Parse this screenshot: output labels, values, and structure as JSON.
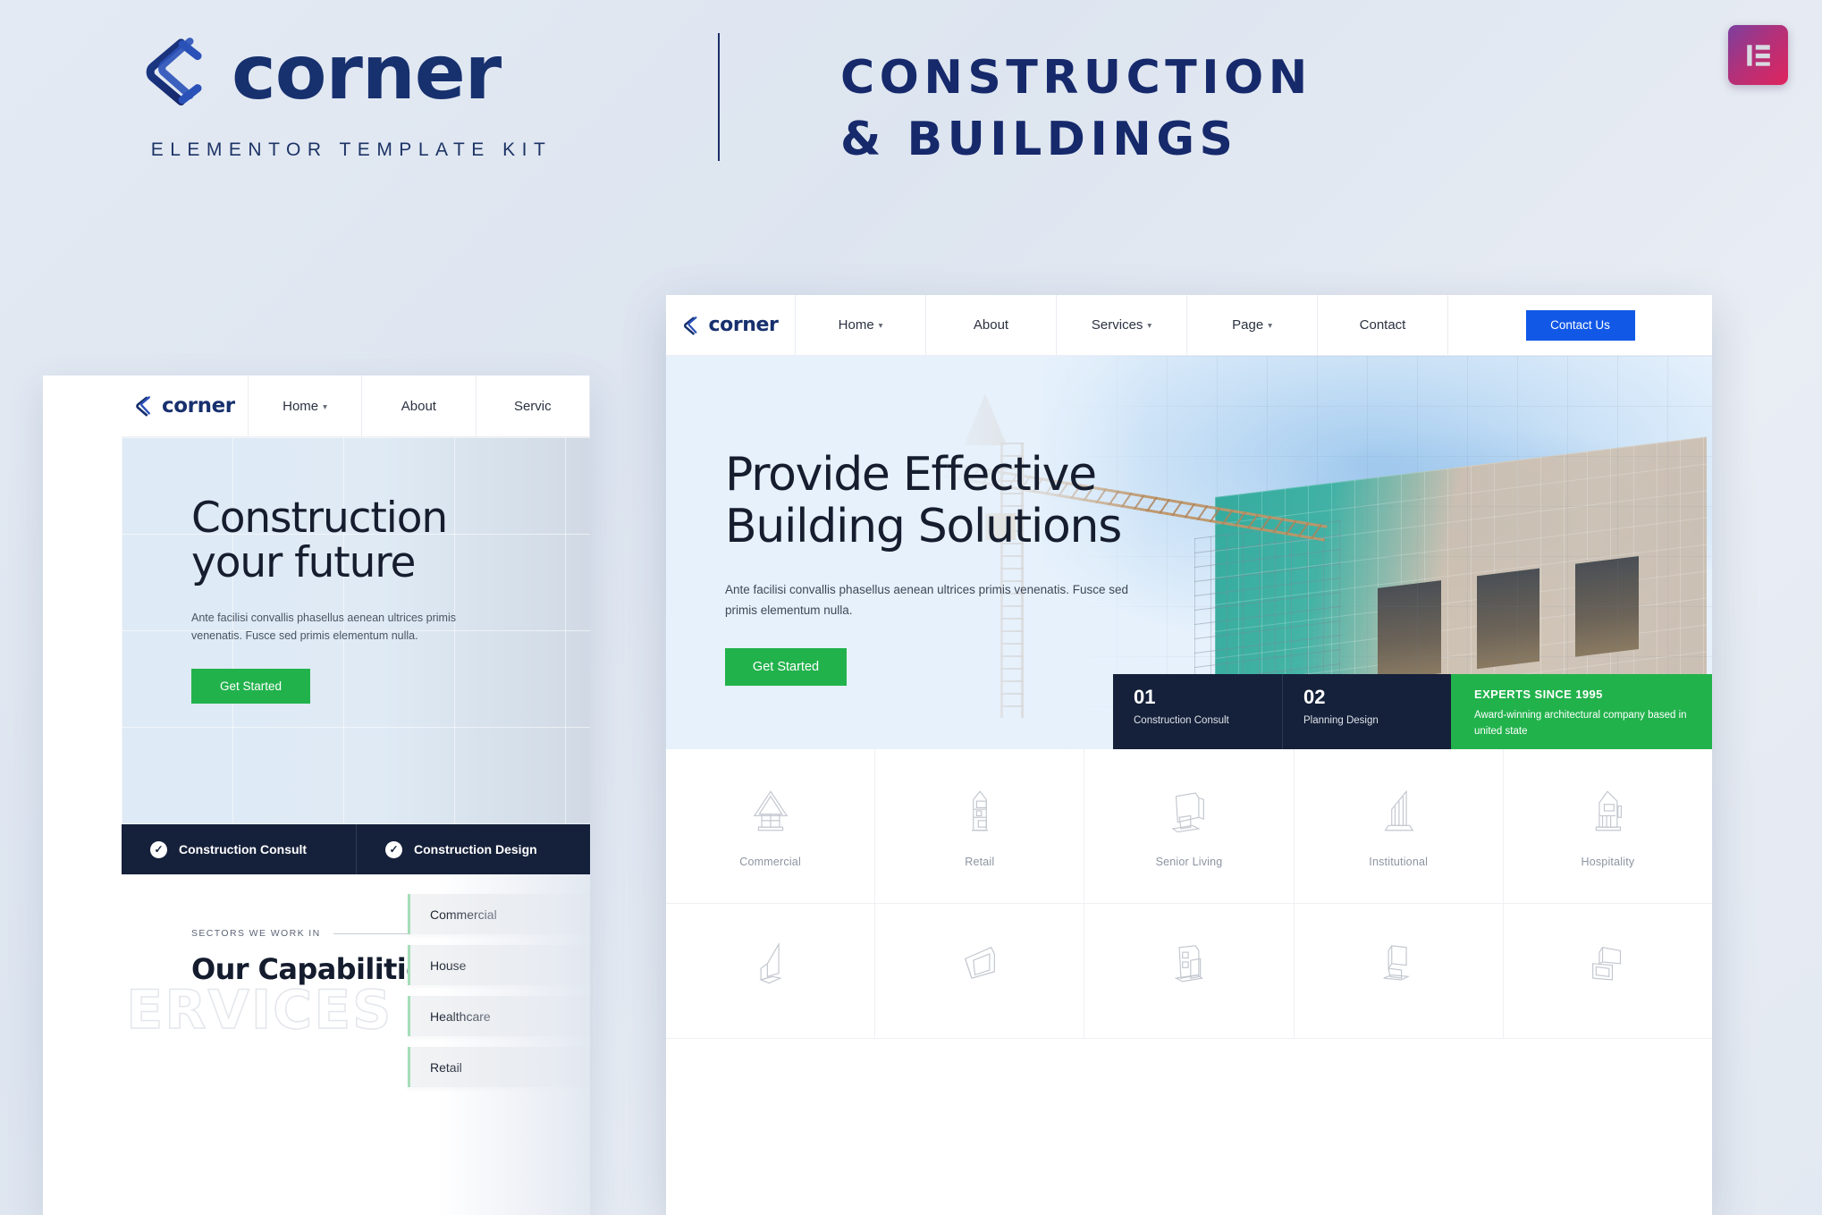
{
  "brand": {
    "logo_word": "corner",
    "tagline": "ELEMENTOR TEMPLATE KIT",
    "title_line1": "CONSTRUCTION",
    "title_line2": "& BUILDINGS",
    "badge_icon": "elementor-icon",
    "colors": {
      "navy": "#17306e",
      "page_bg": "#e4eaf3",
      "green": "#22b24c",
      "blue": "#1158e6",
      "dark": "#15203a"
    }
  },
  "left_mockup": {
    "nav": {
      "logo_word": "corner",
      "items": [
        {
          "label": "Home",
          "has_caret": true
        },
        {
          "label": "About",
          "has_caret": false
        },
        {
          "label": "Servic",
          "has_caret": false
        }
      ]
    },
    "hero": {
      "title_line1": "Construction",
      "title_line2": "your future",
      "description": "Ante facilisi convallis phasellus aenean ultrices primis venenatis. Fusce sed primis elementum nulla.",
      "button": "Get Started"
    },
    "features": [
      {
        "icon": "check-circle-icon",
        "label": "Construction Consult"
      },
      {
        "icon": "check-circle-icon",
        "label": "Construction Design"
      }
    ],
    "services": {
      "eyebrow": "SECTORS WE WORK IN",
      "heading": "Our Capabilities",
      "ghost_text": "SERVICES",
      "sectors": [
        "Commercial",
        "House",
        "Healthcare",
        "Retail"
      ]
    }
  },
  "right_mockup": {
    "nav": {
      "logo_word": "corner",
      "items": [
        {
          "label": "Home",
          "has_caret": true
        },
        {
          "label": "About",
          "has_caret": false
        },
        {
          "label": "Services",
          "has_caret": true
        },
        {
          "label": "Page",
          "has_caret": true
        },
        {
          "label": "Contact",
          "has_caret": false
        }
      ],
      "cta_label": "Contact Us"
    },
    "hero": {
      "title_line1": "Provide Effective",
      "title_line2": "Building Solutions",
      "description_line1": "Ante facilisi convallis phasellus aenean ultrices primis  venenatis. Fusce sed",
      "description_line2": "primis elementum nulla.",
      "button": "Get Started",
      "image_alt": "construction-crane-building-illustration"
    },
    "stats": [
      {
        "number": "01",
        "label": "Construction Consult"
      },
      {
        "number": "02",
        "label": "Planning Design"
      }
    ],
    "highlight": {
      "title": "EXPERTS SINCE 1995",
      "subtitle": "Award-winning architectural company based in united state"
    },
    "sector_grid": {
      "row1": [
        {
          "icon": "house-gable-icon",
          "label": "Commercial"
        },
        {
          "icon": "retail-tower-icon",
          "label": "Retail"
        },
        {
          "icon": "senior-living-icon",
          "label": "Senior Living"
        },
        {
          "icon": "institutional-icon",
          "label": "Institutional"
        },
        {
          "icon": "hospitality-icon",
          "label": "Hospitality"
        }
      ],
      "row2": [
        {
          "icon": "multifamily-icon",
          "label": ""
        },
        {
          "icon": "hall-icon",
          "label": ""
        },
        {
          "icon": "education-icon",
          "label": ""
        },
        {
          "icon": "industrial-icon",
          "label": ""
        },
        {
          "icon": "mixed-use-icon",
          "label": ""
        }
      ]
    }
  }
}
